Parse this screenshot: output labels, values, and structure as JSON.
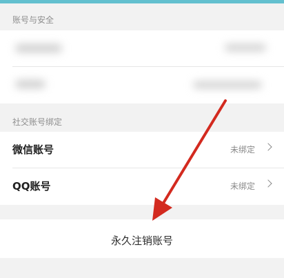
{
  "account_security": {
    "section_title": "账号与安全"
  },
  "social_binding": {
    "section_title": "社交账号绑定",
    "items": [
      {
        "label": "微信账号",
        "status": "未绑定"
      },
      {
        "label": "QQ账号",
        "status": "未绑定"
      }
    ]
  },
  "actions": {
    "delete_account_label": "永久注销账号"
  },
  "colors": {
    "arrow": "#d32a1f",
    "accent_strip": "#63c0cf"
  },
  "icons": {
    "row_chevron": "chevron-right-icon"
  }
}
